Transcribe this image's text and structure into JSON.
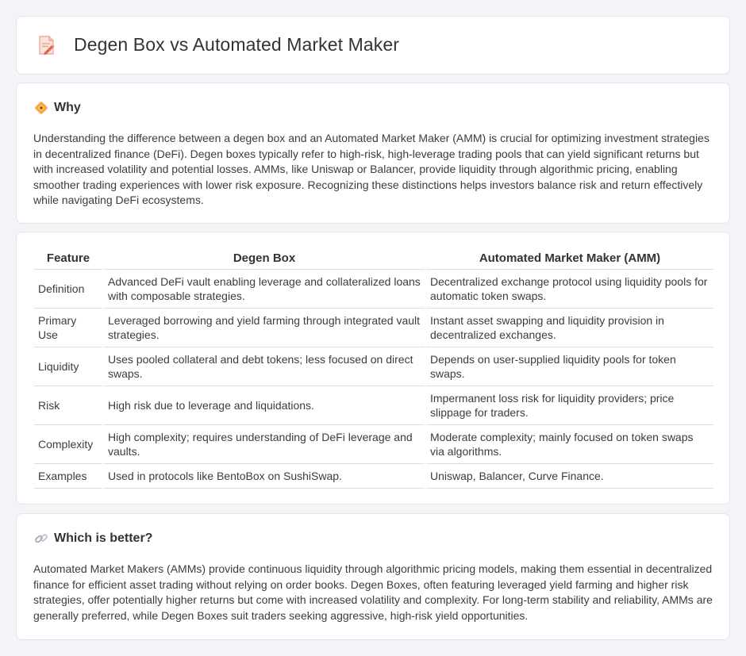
{
  "page": {
    "title": "Degen Box vs Automated Market Maker"
  },
  "why": {
    "heading": "Why",
    "body": "Understanding the difference between a degen box and an Automated Market Maker (AMM) is crucial for optimizing investment strategies in decentralized finance (DeFi). Degen boxes typically refer to high-risk, high-leverage trading pools that can yield significant returns but with increased volatility and potential losses. AMMs, like Uniswap or Balancer, provide liquidity through algorithmic pricing, enabling smoother trading experiences with lower risk exposure. Recognizing these distinctions helps investors balance risk and return effectively while navigating DeFi ecosystems."
  },
  "table": {
    "headers": [
      "Feature",
      "Degen Box",
      "Automated Market Maker (AMM)"
    ],
    "rows": [
      [
        "Definition",
        "Advanced DeFi vault enabling leverage and collateralized loans with composable strategies.",
        "Decentralized exchange protocol using liquidity pools for automatic token swaps."
      ],
      [
        "Primary Use",
        "Leveraged borrowing and yield farming through integrated vault strategies.",
        "Instant asset swapping and liquidity provision in decentralized exchanges."
      ],
      [
        "Liquidity",
        "Uses pooled collateral and debt tokens; less focused on direct swaps.",
        "Depends on user-supplied liquidity pools for token swaps."
      ],
      [
        "Risk",
        "High risk due to leverage and liquidations.",
        "Impermanent loss risk for liquidity providers; price slippage for traders."
      ],
      [
        "Complexity",
        "High complexity; requires understanding of DeFi leverage and vaults.",
        "Moderate complexity; mainly focused on token swaps via algorithms."
      ],
      [
        "Examples",
        "Used in protocols like BentoBox on SushiSwap.",
        "Uniswap, Balancer, Curve Finance."
      ]
    ]
  },
  "better": {
    "heading": "Which is better?",
    "body": "Automated Market Makers (AMMs) provide continuous liquidity through algorithmic pricing models, making them essential in decentralized finance for efficient asset trading without relying on order books. Degen Boxes, often featuring leveraged yield farming and higher risk strategies, offer potentially higher returns but come with increased volatility and complexity. For long-term stability and reliability, AMMs are generally preferred, while Degen Boxes suit traders seeking aggressive, high-risk yield opportunities."
  },
  "icons": {
    "title": "document-pencil-icon",
    "why": "diamond-sign-icon",
    "better": "link-chain-icon"
  }
}
